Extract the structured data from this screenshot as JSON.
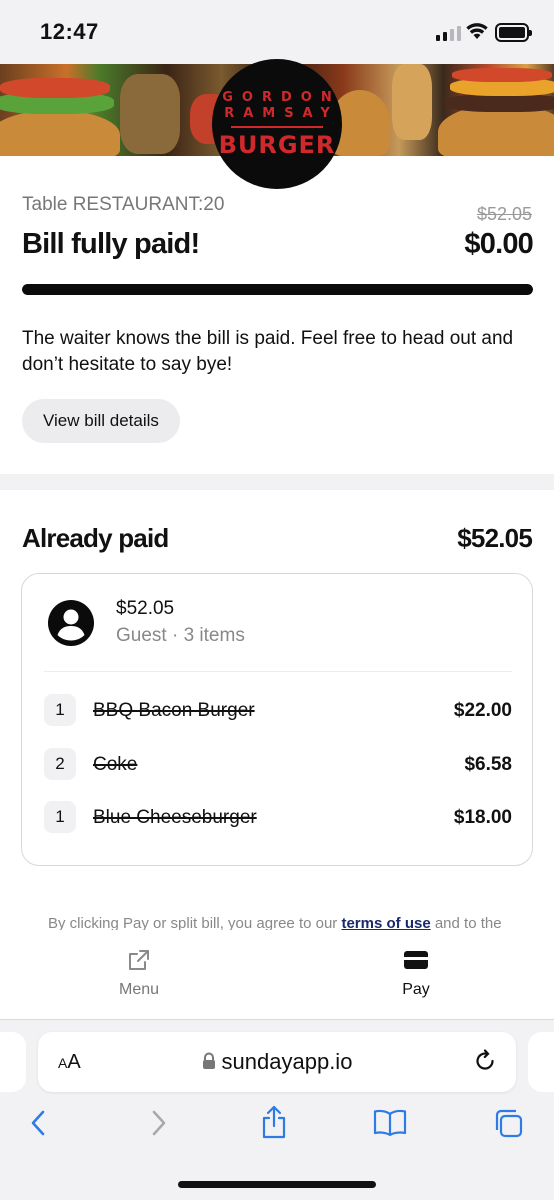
{
  "status_bar": {
    "time": "12:47"
  },
  "brand": {
    "logo_line1": "GORDON",
    "logo_line2": "RAMSAY",
    "logo_line3": "BURGER"
  },
  "summary": {
    "table_label": "Table RESTAURANT:20",
    "original_total": "$52.05",
    "status_title": "Bill fully paid!",
    "remaining_amount": "$0.00",
    "progress_paid_fraction": 1.0,
    "message": "The waiter knows the bill is paid. Feel free to head out and don’t hesitate to say bye!",
    "details_button": "View bill details"
  },
  "already_paid": {
    "title": "Already paid",
    "total": "$52.05",
    "payment": {
      "amount": "$52.05",
      "meta": "Guest · 3 items",
      "items": [
        {
          "qty": "1",
          "name": "BBQ Bacon Burger",
          "price": "$22.00"
        },
        {
          "qty": "2",
          "name": "Coke",
          "price": "$6.58"
        },
        {
          "qty": "1",
          "name": "Blue Cheeseburger",
          "price": "$18.00"
        }
      ]
    },
    "terms_prefix": "By clicking Pay or split bill, you agree to our ",
    "terms_link": "terms of use",
    "terms_suffix": " and to the"
  },
  "bottom_nav": {
    "menu_label": "Menu",
    "pay_label": "Pay"
  },
  "browser": {
    "aa_label": "AA",
    "url": "sundayapp.io"
  },
  "colors": {
    "brand_red": "#d0292b",
    "link_navy": "#1b2a6b",
    "safari_blue": "#2f7be6"
  }
}
